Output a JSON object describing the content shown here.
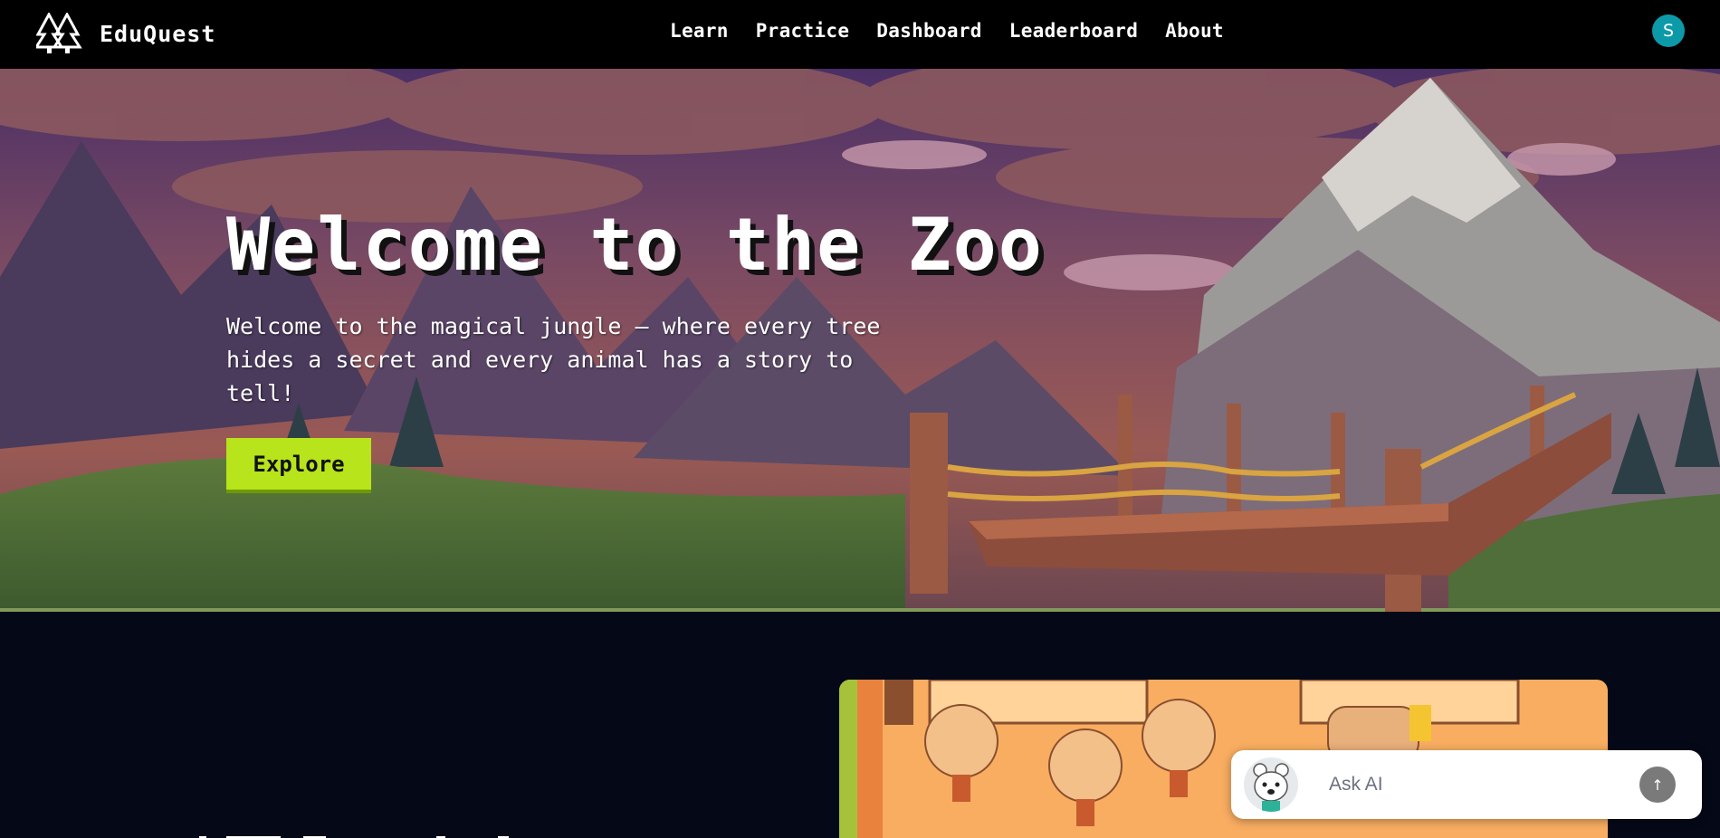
{
  "brand": {
    "name": "EduQuest",
    "logo_icon": "pine-trees-icon"
  },
  "nav": {
    "links": [
      "Learn",
      "Practice",
      "Dashboard",
      "Leaderboard",
      "About"
    ]
  },
  "user": {
    "avatar_initial": "S",
    "avatar_color": "#0d9aa8"
  },
  "hero": {
    "title": "Welcome to the Zoo",
    "subtitle": "Welcome to the magical jungle – where every tree hides a secret and every animal has a story to tell!",
    "cta_label": "Explore",
    "cta_color": "#b7e41b"
  },
  "ask_ai": {
    "placeholder": "Ask AI",
    "send_icon": "arrow-up-icon",
    "avatar_icon": "polar-bear-mascot-icon"
  },
  "colors": {
    "nav_bg": "#000000",
    "page_bg": "#050817"
  }
}
